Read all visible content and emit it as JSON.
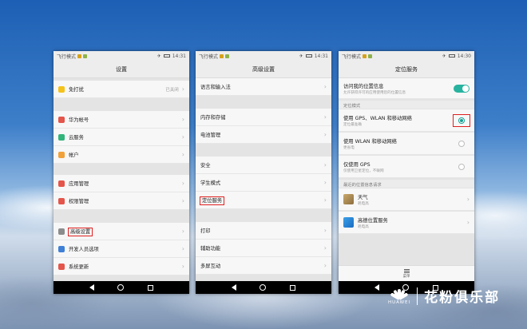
{
  "screen1": {
    "status": {
      "mode": "飞行模式",
      "time": "14:31"
    },
    "title": "设置",
    "rows": [
      {
        "label": "免打扰",
        "meta": "已关闭",
        "color": "#f4c21b"
      },
      {
        "label": "华为帐号",
        "color": "#e4554b"
      },
      {
        "label": "云服务",
        "color": "#33b47a"
      },
      {
        "label": "帐户",
        "color": "#f0a13a"
      },
      {
        "label": "应用管理",
        "color": "#e4554b"
      },
      {
        "label": "权限管理",
        "color": "#e4554b"
      },
      {
        "label": "高级设置",
        "color": "#8c8c8c"
      },
      {
        "label": "开发人员选项",
        "color": "#3f7fd6"
      },
      {
        "label": "系统更新",
        "color": "#e4554b"
      }
    ]
  },
  "screen2": {
    "status": {
      "mode": "飞行模式",
      "time": "14:31"
    },
    "title": "高级设置",
    "rows": [
      {
        "label": "语言和输入法"
      },
      {
        "label": "内存和存储"
      },
      {
        "label": "电池管理"
      },
      {
        "label": "安全"
      },
      {
        "label": "学生模式"
      },
      {
        "label": "定位服务"
      },
      {
        "label": "打印"
      },
      {
        "label": "辅助功能"
      },
      {
        "label": "多屏互动"
      }
    ]
  },
  "screen3": {
    "status": {
      "mode": "飞行模式",
      "time": "14:30"
    },
    "title": "定位服务",
    "access": {
      "title": "访问我的位置信息",
      "subtitle": "允许获得许可的应用使用您的位置信息"
    },
    "section_mode": "定位模式",
    "modes": [
      {
        "title": "使用 GPS、WLAN 和移动网络",
        "subtitle": "定位最准确"
      },
      {
        "title": "使用 WLAN 和移动网络",
        "subtitle": "更省电"
      },
      {
        "title": "仅使用 GPS",
        "subtitle": "仅使用卫星定位，不联网"
      }
    ],
    "section_recent": "最近的位置信息请求",
    "apps": [
      {
        "name": "天气",
        "subtitle": "耗电高"
      },
      {
        "name": "高德位置服务",
        "subtitle": "耗电高"
      }
    ],
    "menu_label": "菜单"
  },
  "watermark": {
    "brand": "HUAWEI",
    "club": "花粉俱乐部"
  }
}
